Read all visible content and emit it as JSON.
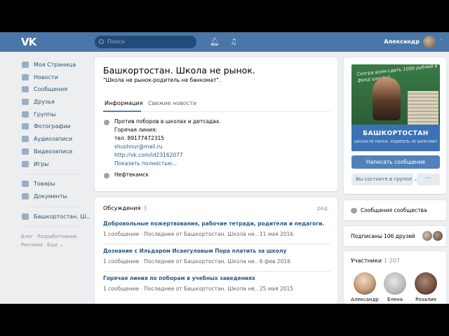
{
  "header": {
    "search_placeholder": "Поиск",
    "user_name": "Александр",
    "chevron": "˅"
  },
  "left_menu": {
    "items": [
      {
        "label": "Моя Страница",
        "icon": "home-icon"
      },
      {
        "label": "Новости",
        "icon": "news-icon"
      },
      {
        "label": "Сообщения",
        "icon": "messages-icon"
      },
      {
        "label": "Друзья",
        "icon": "friends-icon"
      },
      {
        "label": "Группы",
        "icon": "groups-icon"
      },
      {
        "label": "Фотографии",
        "icon": "photos-icon"
      },
      {
        "label": "Аудиозаписи",
        "icon": "audio-icon"
      },
      {
        "label": "Видеозаписи",
        "icon": "video-icon"
      },
      {
        "label": "Игры",
        "icon": "games-icon"
      }
    ],
    "items2": [
      {
        "label": "Товары",
        "icon": "goods-icon"
      },
      {
        "label": "Документы",
        "icon": "documents-icon"
      }
    ],
    "pinned": {
      "label": "Башкортостан. Ш..",
      "icon": "community-icon"
    },
    "footer": {
      "blog": "Блог",
      "devs": "Разработчикам",
      "ads": "Реклама",
      "more": "Еще ⌄"
    }
  },
  "group": {
    "name": "Башкортостан. Школа не рынок.",
    "status": "\"Школа не рынок-родитель не банкомат\".",
    "tabs": [
      "Информация",
      "Свежие новости"
    ],
    "info_lines": [
      "Против поборов в школах и детсадах.",
      "Горячая линия:",
      "тел. 89177472315",
      "shushnur@mail.ru",
      "http://vk.com/id23162077"
    ],
    "show_more": "Показать полностью...",
    "city": "Нефтекамск"
  },
  "discussions": {
    "title": "Обсуждения",
    "count": "3",
    "edit": "ред.",
    "topics": [
      {
        "title": "Добровольные пожертвования, рабочие тетради, родители и педагоги.",
        "meta": "1 сообщение  ·  Последнее от Башкортостан. Школа не.. 11 мая 2016"
      },
      {
        "title": "Дознание с Ильдаром Исангуловым Пора платить за школу",
        "meta": "1 сообщение  ·  Последнее от Башкортостан. Школа не.. 6 фев 2016"
      },
      {
        "title": "Горячая линия по поборам в учебных заведениях",
        "meta": "1 сообщение  ·  Последнее от Башкортостан. Школа не.. 25 мая 2015"
      }
    ]
  },
  "cover": {
    "text": "Скогра всем сдать 1000 рублей в фонд школы!",
    "title": "БАШКОРТОСТАН",
    "subtitle": "ШКОЛА НЕ РЫНОК. РОДИТЕЛЬ НЕ БАНКОМАТ"
  },
  "actions": {
    "write_message": "Написать сообщение",
    "membership": "Вы состоите в группе ⌄",
    "more": "···"
  },
  "community_messages": "Сообщения сообщества",
  "subscribers": "Подписаны 106 друзей",
  "members": {
    "title": "Участники",
    "count": "1 207",
    "people": [
      "Александр",
      "Елена",
      "Розалия"
    ]
  },
  "colors": {
    "header": "#4a76a8",
    "accent": "#5181b8",
    "link": "#2a5885",
    "background": "#edeef0"
  }
}
